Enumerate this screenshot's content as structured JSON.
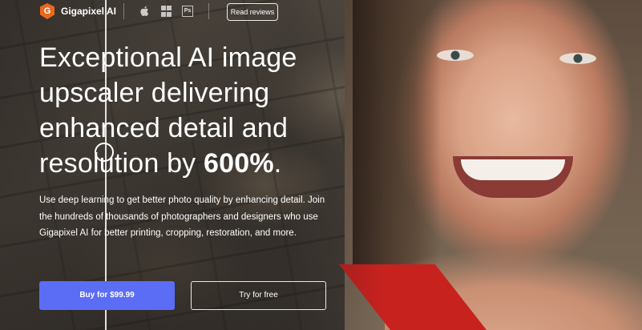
{
  "nav": {
    "logo_letter": "G",
    "brand": "Gigapixel AI",
    "os_icons": [
      "apple-icon",
      "windows-icon",
      "photoshop-icon"
    ],
    "photoshop_label": "Ps",
    "reviews_label": "Read reviews"
  },
  "hero": {
    "headline_plain": "Exceptional AI image upscaler delivering enhanced detail and resolution by ",
    "headline_bold": "600%",
    "headline_end": ".",
    "description": "Use deep learning to get better photo quality by enhancing detail. Join the hundreds of thousands of photographers and designers who use Gigapixel AI for better printing, cropping, restoration, and more."
  },
  "buttons": {
    "buy_label": "Buy for $99.99",
    "try_label": "Try for free"
  },
  "colors": {
    "accent": "#5b6cf5",
    "logo": "#e9691e",
    "strap": "#c8221f"
  }
}
